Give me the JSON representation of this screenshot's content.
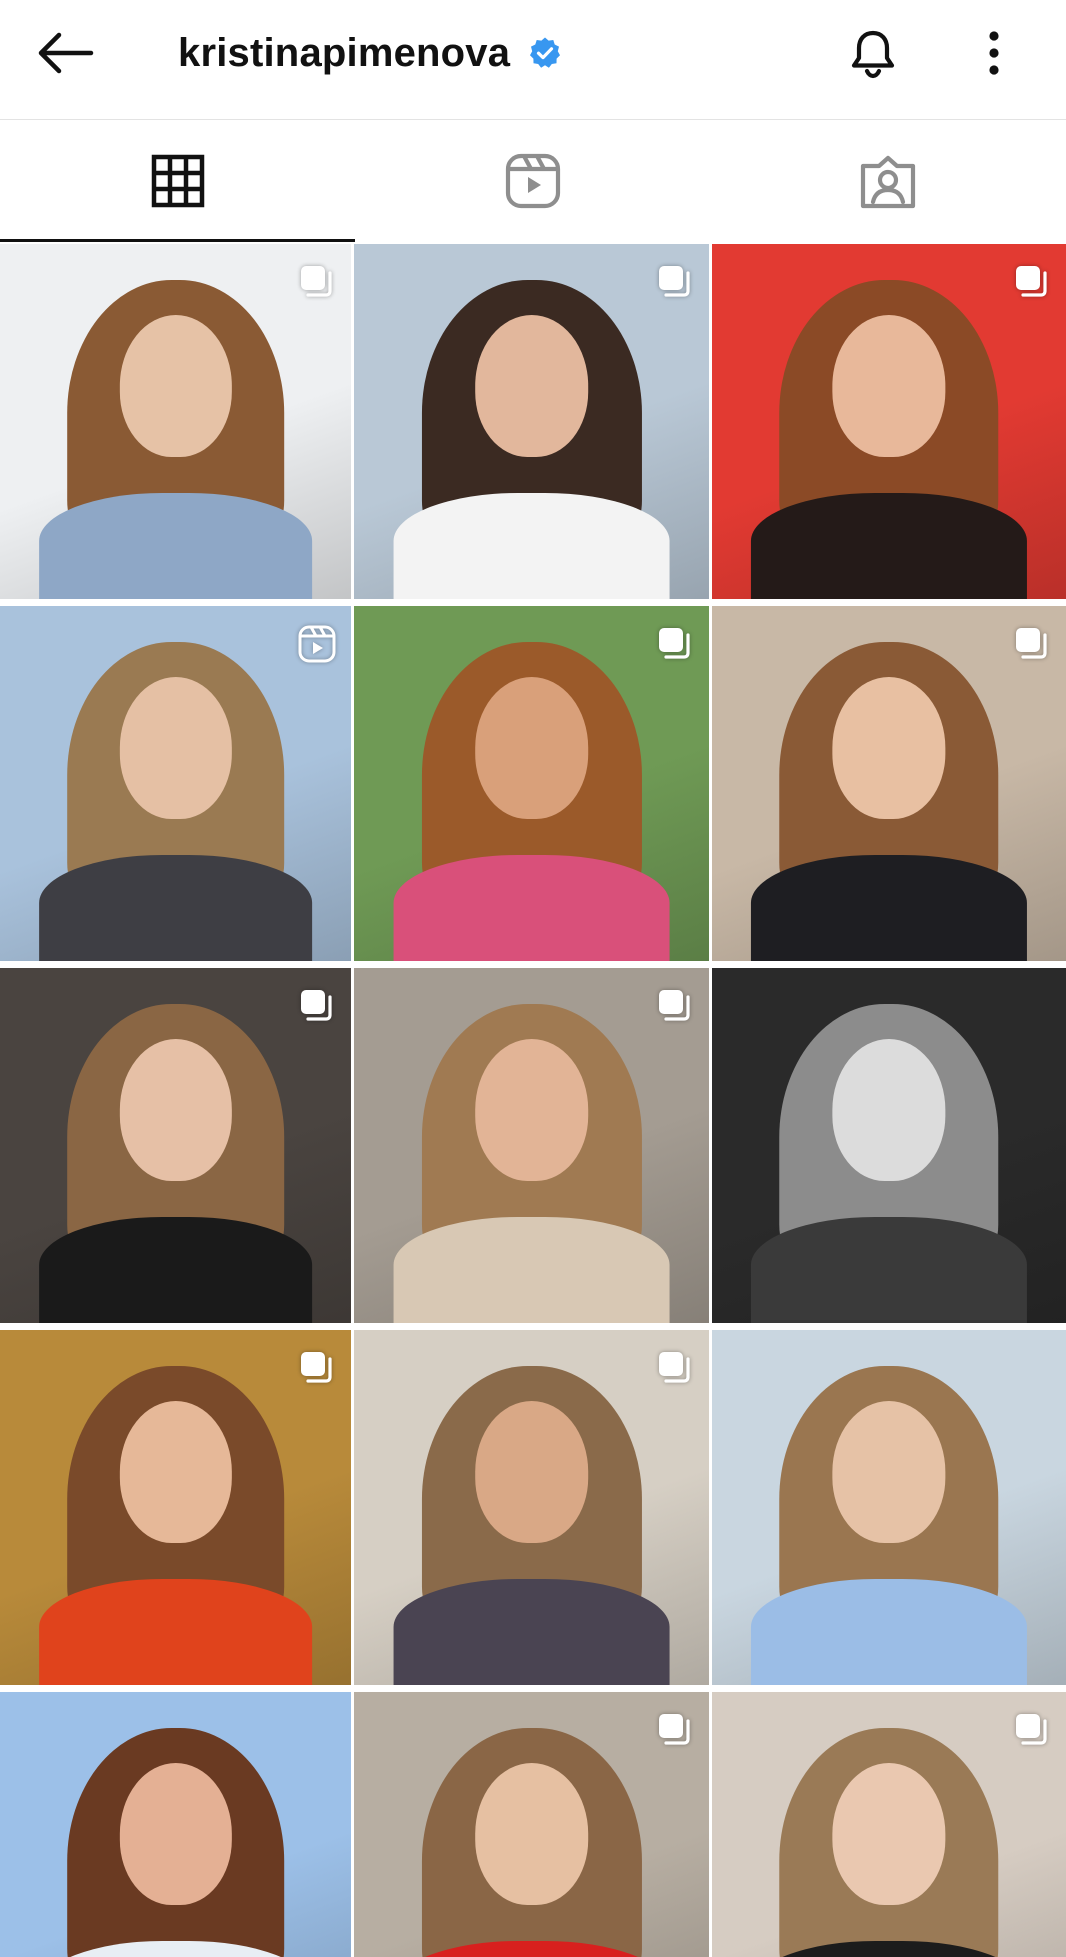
{
  "header": {
    "username": "kristinapimenova",
    "verified": true,
    "icons": {
      "back": "arrow-left-icon",
      "verified": "verified-badge-icon",
      "notifications": "bell-icon",
      "more": "more-vertical-icon"
    }
  },
  "tabs": [
    {
      "id": "posts",
      "icon": "grid-icon",
      "active": true
    },
    {
      "id": "reels",
      "icon": "reels-icon",
      "active": false
    },
    {
      "id": "tagged",
      "icon": "tagged-icon",
      "active": false
    }
  ],
  "colors": {
    "verified_blue": "#3897f0",
    "text_primary": "#111111",
    "divider": "#e3e3e3"
  },
  "posts": [
    {
      "type": "carousel",
      "palette": {
        "bg": "#eef0f2",
        "hair": "#8a5a34",
        "skin": "#e6c2a6",
        "body": "#8ea7c6"
      }
    },
    {
      "type": "carousel",
      "palette": {
        "bg": "#b9c8d6",
        "hair": "#3b2a22",
        "skin": "#e2b79c",
        "body": "#f3f3f3"
      }
    },
    {
      "type": "carousel",
      "palette": {
        "bg": "#e23a32",
        "hair": "#8b4a26",
        "skin": "#e8b89a",
        "body": "#241a18"
      }
    },
    {
      "type": "reel",
      "palette": {
        "bg": "#a9c2dc",
        "hair": "#9a7a52",
        "skin": "#e5c0a4",
        "body": "#3e3e44"
      }
    },
    {
      "type": "carousel",
      "palette": {
        "bg": "#6f9a55",
        "hair": "#9b5a2a",
        "skin": "#d9a07a",
        "body": "#d9507a"
      }
    },
    {
      "type": "carousel",
      "palette": {
        "bg": "#c8b8a6",
        "hair": "#8a5a36",
        "skin": "#e8c0a2",
        "body": "#1e1e22"
      }
    },
    {
      "type": "carousel",
      "palette": {
        "bg": "#4a4440",
        "hair": "#8a6644",
        "skin": "#e6c0a6",
        "body": "#1a1a1a"
      }
    },
    {
      "type": "carousel",
      "palette": {
        "bg": "#a49c92",
        "hair": "#a07a52",
        "skin": "#e2b496",
        "body": "#d8c8b4"
      }
    },
    {
      "type": "image",
      "palette": {
        "bg": "#2a2a2a",
        "hair": "#8c8c8c",
        "skin": "#dcdcdc",
        "body": "#3a3a3a"
      }
    },
    {
      "type": "carousel",
      "palette": {
        "bg": "#b88a3a",
        "hair": "#7a4a2a",
        "skin": "#e6b898",
        "body": "#e0431c"
      }
    },
    {
      "type": "carousel",
      "palette": {
        "bg": "#d6cfc4",
        "hair": "#8a6a4a",
        "skin": "#d9a886",
        "body": "#4a4452"
      }
    },
    {
      "type": "image",
      "palette": {
        "bg": "#c9d6e0",
        "hair": "#9a7650",
        "skin": "#e6c2a6",
        "body": "#9bbde6"
      }
    },
    {
      "type": "image",
      "palette": {
        "bg": "#9cc0e8",
        "hair": "#6a3a22",
        "skin": "#e4b094",
        "body": "#e8eef4"
      }
    },
    {
      "type": "carousel",
      "palette": {
        "bg": "#b7aea2",
        "hair": "#8a6646",
        "skin": "#e6c0a2",
        "body": "#d8201e"
      }
    },
    {
      "type": "carousel",
      "palette": {
        "bg": "#d6ccc2",
        "hair": "#9a7a56",
        "skin": "#eac8b0",
        "body": "#1c1c1c"
      }
    }
  ]
}
